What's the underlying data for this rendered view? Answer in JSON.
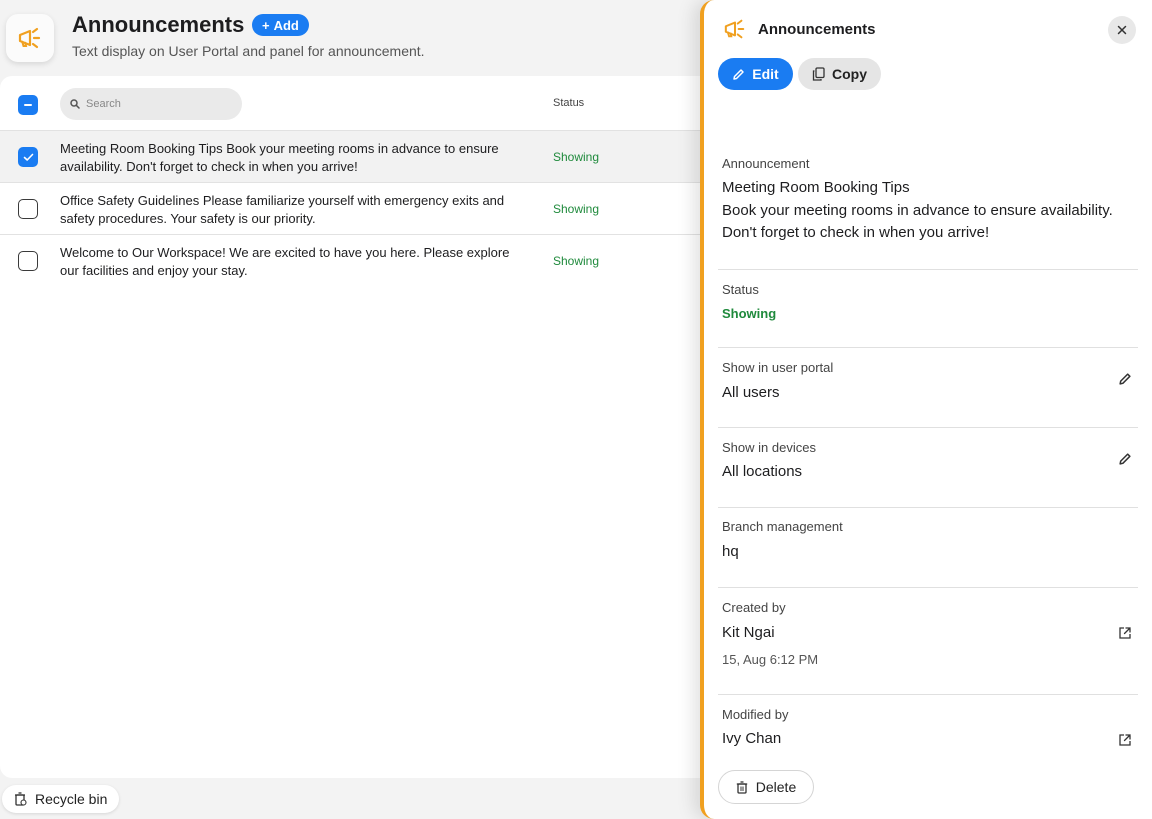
{
  "header": {
    "title": "Announcements",
    "add_label": "Add",
    "subtitle": "Text display on User Portal and panel for announcement."
  },
  "table": {
    "search_placeholder": "Search",
    "status_header": "Status",
    "rows": [
      {
        "text": "Meeting Room Booking Tips Book your meeting rooms in advance to ensure availability. Don't forget to check in when you arrive!",
        "status": "Showing",
        "checked": true
      },
      {
        "text": "Office Safety Guidelines Please familiarize yourself with emergency exits and safety procedures. Your safety is our priority.",
        "status": "Showing",
        "checked": false
      },
      {
        "text": "Welcome to Our Workspace! We are excited to have you here. Please explore our facilities and enjoy your stay.",
        "status": "Showing",
        "checked": false
      }
    ]
  },
  "footer": {
    "recycle_label": "Recycle bin"
  },
  "panel": {
    "title": "Announcements",
    "edit_label": "Edit",
    "copy_label": "Copy",
    "announcement_label": "Announcement",
    "announcement_title": "Meeting Room Booking Tips",
    "announcement_body": "Book your meeting rooms in advance to ensure availability. Don't forget to check in when you arrive!",
    "status_label": "Status",
    "status_value": "Showing",
    "portal_label": "Show in user portal",
    "portal_value": "All users",
    "devices_label": "Show in devices",
    "devices_value": "All locations",
    "branch_label": "Branch management",
    "branch_value": "hq",
    "created_label": "Created by",
    "created_value": "Kit Ngai",
    "created_time": "15, Aug 6:12 PM",
    "modified_label": "Modified by",
    "modified_value": "Ivy Chan",
    "delete_label": "Delete"
  },
  "colors": {
    "accent": "#1a7cf2",
    "brand_orange": "#f0a020",
    "status_green": "#1f8a3c"
  },
  "icons": [
    "megaphone-icon",
    "plus-icon",
    "search-icon",
    "check-icon",
    "minus-icon",
    "close-icon",
    "pencil-icon",
    "copy-icon",
    "external-link-icon",
    "trash-icon",
    "recycle-bin-icon"
  ]
}
